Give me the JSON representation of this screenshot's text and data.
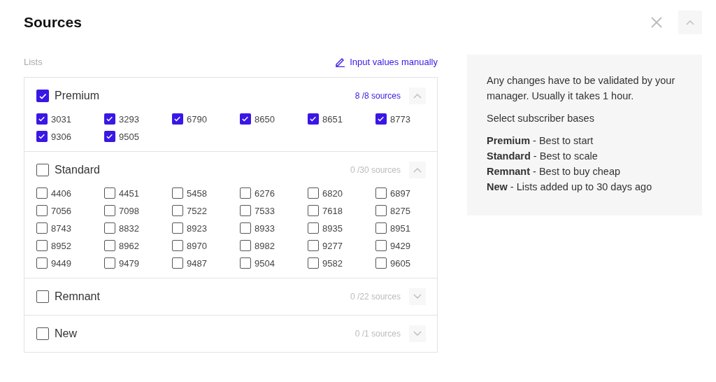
{
  "title": "Sources",
  "lists_label": "Lists",
  "manual_link": "Input values manually",
  "groups": [
    {
      "name": "Premium",
      "checked": true,
      "expanded": true,
      "count": "8 /8  sources",
      "items": [
        {
          "label": "3031",
          "checked": true
        },
        {
          "label": "3293",
          "checked": true
        },
        {
          "label": "6790",
          "checked": true
        },
        {
          "label": "8650",
          "checked": true
        },
        {
          "label": "8651",
          "checked": true
        },
        {
          "label": "8773",
          "checked": true
        },
        {
          "label": "9306",
          "checked": true
        },
        {
          "label": "9505",
          "checked": true
        }
      ]
    },
    {
      "name": "Standard",
      "checked": false,
      "expanded": true,
      "count": "0 /30 sources",
      "items": [
        {
          "label": "4406",
          "checked": false
        },
        {
          "label": "4451",
          "checked": false
        },
        {
          "label": "5458",
          "checked": false
        },
        {
          "label": "6276",
          "checked": false
        },
        {
          "label": "6820",
          "checked": false
        },
        {
          "label": "6897",
          "checked": false
        },
        {
          "label": "7056",
          "checked": false
        },
        {
          "label": "7098",
          "checked": false
        },
        {
          "label": "7522",
          "checked": false
        },
        {
          "label": "7533",
          "checked": false
        },
        {
          "label": "7618",
          "checked": false
        },
        {
          "label": "8275",
          "checked": false
        },
        {
          "label": "8743",
          "checked": false
        },
        {
          "label": "8832",
          "checked": false
        },
        {
          "label": "8923",
          "checked": false
        },
        {
          "label": "8933",
          "checked": false
        },
        {
          "label": "8935",
          "checked": false
        },
        {
          "label": "8951",
          "checked": false
        },
        {
          "label": "8952",
          "checked": false
        },
        {
          "label": "8962",
          "checked": false
        },
        {
          "label": "8970",
          "checked": false
        },
        {
          "label": "8982",
          "checked": false
        },
        {
          "label": "9277",
          "checked": false
        },
        {
          "label": "9429",
          "checked": false
        },
        {
          "label": "9449",
          "checked": false
        },
        {
          "label": "9479",
          "checked": false
        },
        {
          "label": "9487",
          "checked": false
        },
        {
          "label": "9504",
          "checked": false
        },
        {
          "label": "9582",
          "checked": false
        },
        {
          "label": "9605",
          "checked": false
        }
      ]
    },
    {
      "name": "Remnant",
      "checked": false,
      "expanded": false,
      "count": "0 /22 sources"
    },
    {
      "name": "New",
      "checked": false,
      "expanded": false,
      "count": "0 /1 sources"
    }
  ],
  "info": {
    "note": "Any changes have to be validated by your manager. Usually it takes 1 hour.",
    "heading": "Select subscriber bases",
    "lines": [
      "**Premium** - Best to start",
      "**Standard** - Best to scale",
      "**Remnant** - Best to buy cheap",
      "**New** - Lists added up to 30 days ago"
    ]
  }
}
